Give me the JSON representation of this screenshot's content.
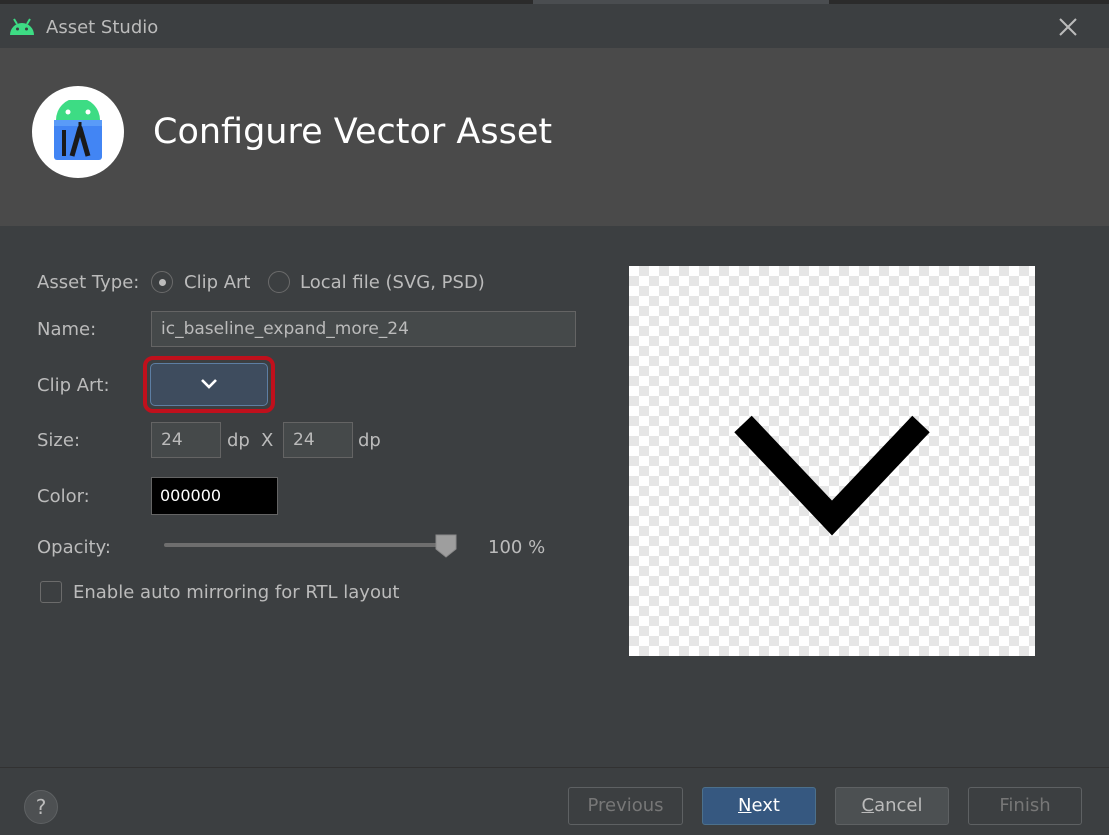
{
  "window": {
    "title": "Asset Studio",
    "close_icon": "close-icon"
  },
  "banner": {
    "heading": "Configure Vector Asset",
    "logo_icon": "android-studio-logo"
  },
  "form": {
    "asset_type": {
      "label": "Asset Type:",
      "options": [
        "Clip Art",
        "Local file (SVG, PSD)"
      ],
      "selected": "Clip Art"
    },
    "name": {
      "label": "Name:",
      "value": "ic_baseline_expand_more_24"
    },
    "clip_art": {
      "label": "Clip Art:",
      "icon": "chevron-down-icon"
    },
    "size": {
      "label": "Size:",
      "width": "24",
      "height": "24",
      "unit": "dp",
      "separator": "X"
    },
    "color": {
      "label": "Color:",
      "value": "000000"
    },
    "opacity": {
      "label": "Opacity:",
      "value": 100,
      "display": "100 %"
    },
    "auto_mirror": {
      "label": "Enable auto mirroring for RTL layout",
      "checked": false
    }
  },
  "preview": {
    "icon": "expand-more-icon"
  },
  "footer": {
    "help": "?",
    "previous": {
      "label": "Previous",
      "enabled": false
    },
    "next": {
      "mnemonic": "N",
      "rest": "ext",
      "enabled": true
    },
    "cancel": {
      "mnemonic": "C",
      "rest": "ancel",
      "enabled": true
    },
    "finish": {
      "label": "Finish",
      "enabled": false
    }
  },
  "colors": {
    "background": "#3c3f41",
    "banner": "#4a4a4a",
    "highlight": "#c0101c",
    "primary_button": "#365880"
  }
}
